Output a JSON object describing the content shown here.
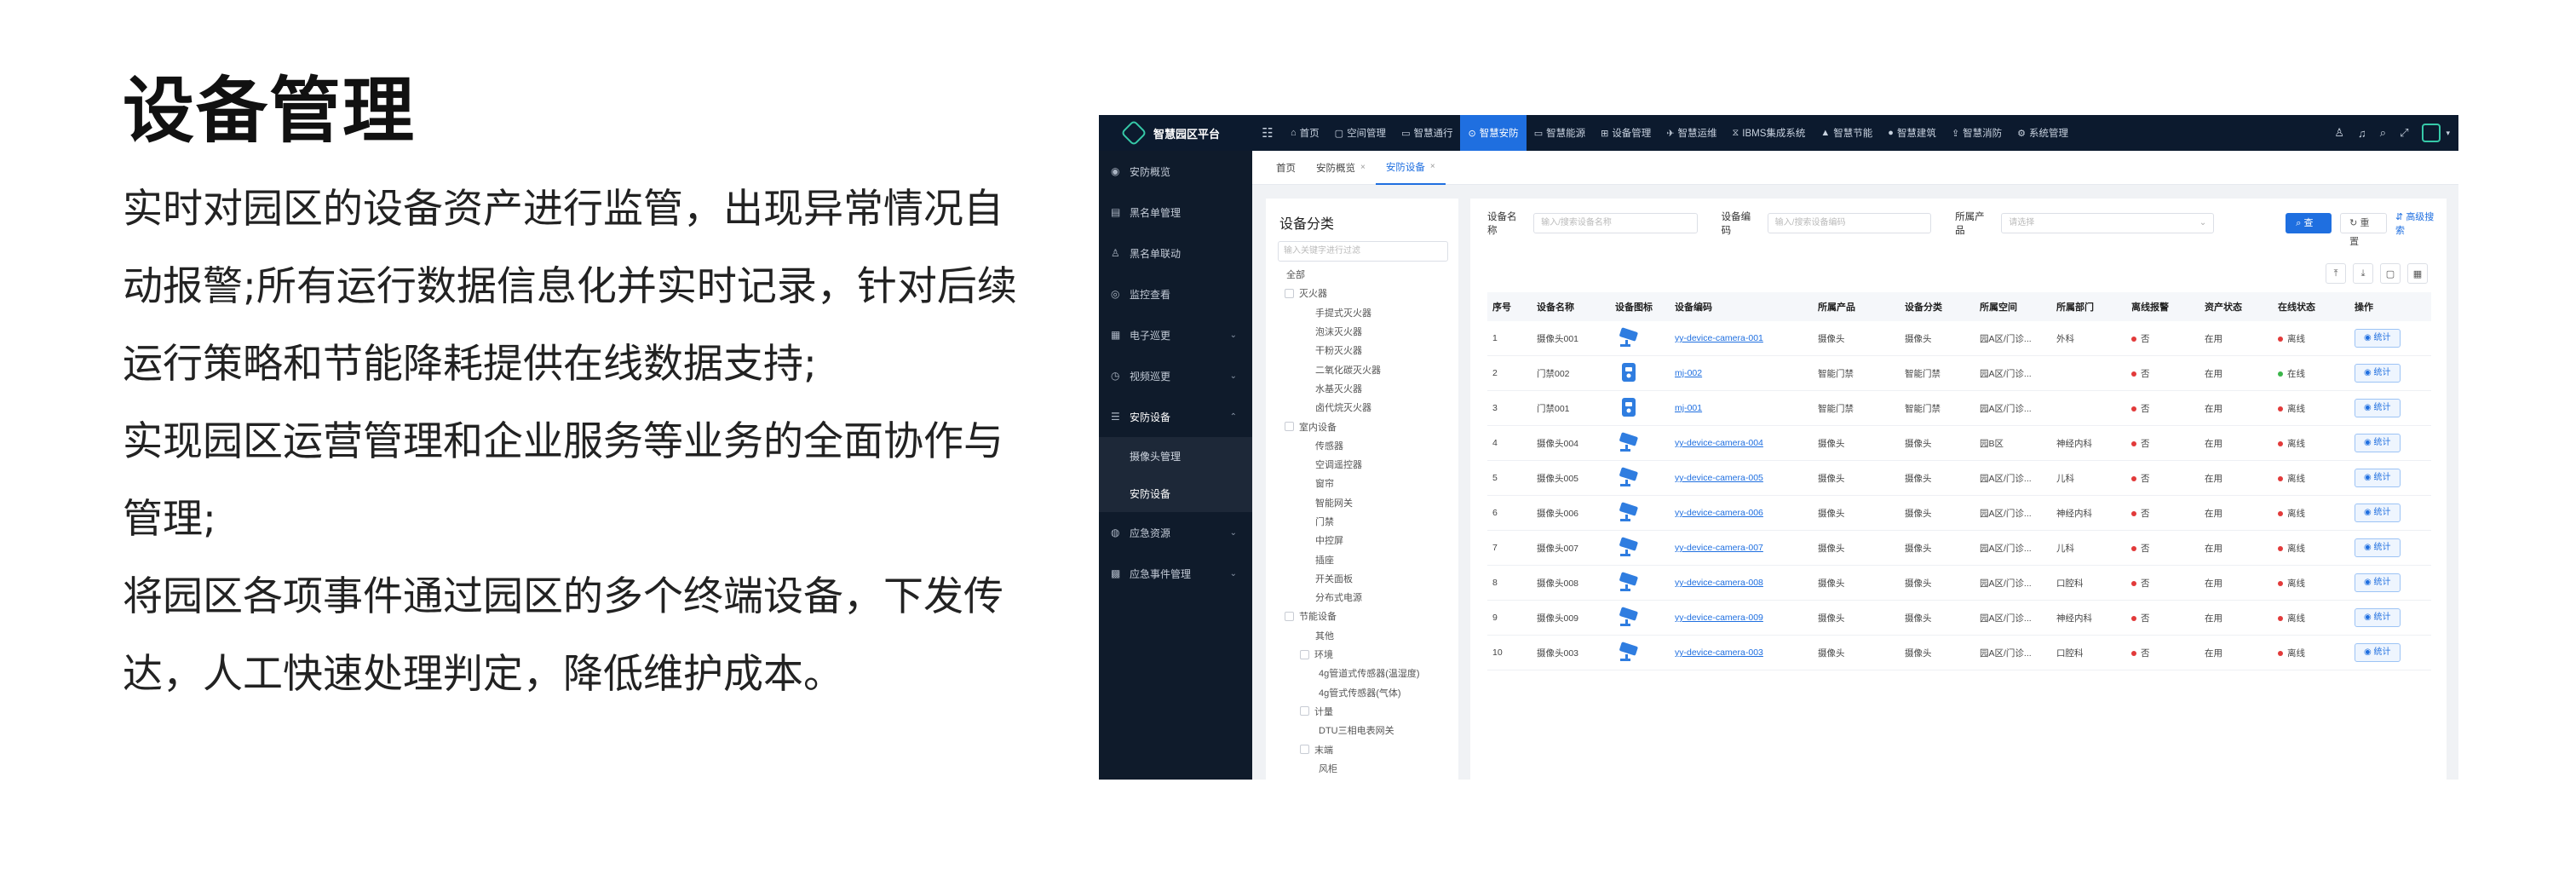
{
  "intro": {
    "title": "设备管理",
    "paragraphs": [
      "实时对园区的设备资产进行监管，出现异常情况自动报警;所有运行数据信息化并实时记录，针对后续运行策略和节能降耗提供在线数据支持;",
      "实现园区运营管理和企业服务等业务的全面协作与管理;",
      "将园区各项事件通过园区的多个终端设备，下发传达，人工快速处理判定，降低维护成本。"
    ]
  },
  "app": {
    "brand": "智慧园区平台",
    "nav": [
      {
        "label": "首页",
        "icon": "home-icon",
        "glyph": "⌂",
        "active": false
      },
      {
        "label": "空间管理",
        "icon": "space-icon",
        "glyph": "▢",
        "active": false
      },
      {
        "label": "智慧通行",
        "icon": "pass-icon",
        "glyph": "▭",
        "active": false
      },
      {
        "label": "智慧安防",
        "icon": "shield-icon",
        "glyph": "⊙",
        "active": true
      },
      {
        "label": "智慧能源",
        "icon": "energy-icon",
        "glyph": "▭",
        "active": false
      },
      {
        "label": "设备管理",
        "icon": "device-icon",
        "glyph": "⊞",
        "active": false
      },
      {
        "label": "智慧运维",
        "icon": "ops-icon",
        "glyph": "✈",
        "active": false
      },
      {
        "label": "IBMS集成系统",
        "icon": "ibms-icon",
        "glyph": "⧖",
        "active": false
      },
      {
        "label": "智慧节能",
        "icon": "saving-icon",
        "glyph": "▲",
        "active": false
      },
      {
        "label": "智慧建筑",
        "icon": "building-icon",
        "glyph": "●",
        "active": false
      },
      {
        "label": "智慧消防",
        "icon": "fire-icon",
        "glyph": "⇪",
        "active": false
      },
      {
        "label": "系统管理",
        "icon": "gear-icon",
        "glyph": "⚙",
        "active": false
      }
    ],
    "sidebar": [
      {
        "label": "安防概览",
        "icon": "overview-icon",
        "glyph": "◉",
        "arrow": false
      },
      {
        "label": "黑名单管理",
        "icon": "blacklist-icon",
        "glyph": "▤",
        "arrow": false
      },
      {
        "label": "黑名单联动",
        "icon": "link-icon",
        "glyph": "♙",
        "arrow": false
      },
      {
        "label": "监控查看",
        "icon": "eye-icon",
        "glyph": "◎",
        "arrow": false
      },
      {
        "label": "电子巡更",
        "icon": "patrol-icon",
        "glyph": "▦",
        "arrow": true
      },
      {
        "label": "视频巡更",
        "icon": "video-icon",
        "glyph": "◷",
        "arrow": true
      },
      {
        "label": "安防设备",
        "icon": "list-icon",
        "glyph": "☰",
        "arrow": true
      }
    ],
    "sidebar_sub": [
      "摄像头管理",
      "安防设备"
    ],
    "sidebar_after": [
      {
        "label": "应急资源",
        "icon": "emergency-icon",
        "glyph": "◍",
        "arrow": true
      },
      {
        "label": "应急事件管理",
        "icon": "event-icon",
        "glyph": "▩",
        "arrow": true
      }
    ],
    "tabs": [
      {
        "label": "首页",
        "closable": false
      },
      {
        "label": "安防概览",
        "closable": true
      },
      {
        "label": "安防设备",
        "closable": true
      }
    ],
    "tree": {
      "title": "设备分类",
      "search_placeholder": "输入关键字进行过滤",
      "nodes": [
        {
          "label": "全部",
          "level": "l0",
          "cb": false
        },
        {
          "label": "灭火器",
          "level": "l1",
          "cb": true
        },
        {
          "label": "手提式灭火器",
          "level": "l2",
          "cb": false
        },
        {
          "label": "泡沫灭火器",
          "level": "l2",
          "cb": false
        },
        {
          "label": "干粉灭火器",
          "level": "l2",
          "cb": false
        },
        {
          "label": "二氧化碳灭火器",
          "level": "l2",
          "cb": false
        },
        {
          "label": "水基灭火器",
          "level": "l2",
          "cb": false
        },
        {
          "label": "卤代烷灭火器",
          "level": "l2",
          "cb": false
        },
        {
          "label": "室内设备",
          "level": "l1",
          "cb": true
        },
        {
          "label": "传感器",
          "level": "l2",
          "cb": false
        },
        {
          "label": "空调遥控器",
          "level": "l2",
          "cb": false
        },
        {
          "label": "窗帘",
          "level": "l2",
          "cb": false
        },
        {
          "label": "智能网关",
          "level": "l2",
          "cb": false
        },
        {
          "label": "门禁",
          "level": "l2",
          "cb": false
        },
        {
          "label": "中控屏",
          "level": "l2",
          "cb": false
        },
        {
          "label": "插座",
          "level": "l2",
          "cb": false
        },
        {
          "label": "开关面板",
          "level": "l2",
          "cb": false
        },
        {
          "label": "分布式电源",
          "level": "l2",
          "cb": false
        },
        {
          "label": "节能设备",
          "level": "l1",
          "cb": true
        },
        {
          "label": "其他",
          "level": "l2",
          "cb": false
        },
        {
          "label": "环境",
          "level": "l2b",
          "cb": true
        },
        {
          "label": "4g管道式传感器(温湿度)",
          "level": "l3",
          "cb": false
        },
        {
          "label": "4g管式传感器(气体)",
          "level": "l3",
          "cb": false
        },
        {
          "label": "计量",
          "level": "l2b",
          "cb": true
        },
        {
          "label": "DTU三相电表网关",
          "level": "l3",
          "cb": false
        },
        {
          "label": "末端",
          "level": "l2b",
          "cb": true
        },
        {
          "label": "风柜",
          "level": "l3",
          "cb": false
        }
      ]
    },
    "filters": {
      "name_label": "设备名称",
      "name_placeholder": "输入/搜索设备名称",
      "code_label": "设备编码",
      "code_placeholder": "输入/搜索设备编码",
      "product_label": "所属产品",
      "product_placeholder": "请选择",
      "query": "查询",
      "reset": "重置",
      "advanced": "高级搜索"
    },
    "table": {
      "headers": [
        "序号",
        "设备名称",
        "设备图标",
        "设备编码",
        "所属产品",
        "设备分类",
        "所属空间",
        "所属部门",
        "离线报警",
        "资产状态",
        "在线状态",
        "操作"
      ],
      "rows": [
        {
          "no": "1",
          "name": "摄像头001",
          "icon": "camera-icon",
          "code": "yy-device-camera-001",
          "product": "摄像头",
          "category": "摄像头",
          "space": "园A区/门诊...",
          "dept": "外科",
          "alarm": "否",
          "asset": "在用",
          "online": "离线",
          "online_ok": false,
          "op": "统计"
        },
        {
          "no": "2",
          "name": "门禁002",
          "icon": "door-icon",
          "code": "mj-002",
          "product": "智能门禁",
          "category": "智能门禁",
          "space": "园A区/门诊...",
          "dept": "",
          "alarm": "否",
          "asset": "在用",
          "online": "在线",
          "online_ok": true,
          "op": "统计"
        },
        {
          "no": "3",
          "name": "门禁001",
          "icon": "door-icon",
          "code": "mj-001",
          "product": "智能门禁",
          "category": "智能门禁",
          "space": "园A区/门诊...",
          "dept": "",
          "alarm": "否",
          "asset": "在用",
          "online": "离线",
          "online_ok": false,
          "op": "统计"
        },
        {
          "no": "4",
          "name": "摄像头004",
          "icon": "camera-icon",
          "code": "yy-device-camera-004",
          "product": "摄像头",
          "category": "摄像头",
          "space": "园B区",
          "dept": "神经内科",
          "alarm": "否",
          "asset": "在用",
          "online": "离线",
          "online_ok": false,
          "op": "统计"
        },
        {
          "no": "5",
          "name": "摄像头005",
          "icon": "camera-icon",
          "code": "yy-device-camera-005",
          "product": "摄像头",
          "category": "摄像头",
          "space": "园A区/门诊...",
          "dept": "儿科",
          "alarm": "否",
          "asset": "在用",
          "online": "离线",
          "online_ok": false,
          "op": "统计"
        },
        {
          "no": "6",
          "name": "摄像头006",
          "icon": "camera-icon",
          "code": "yy-device-camera-006",
          "product": "摄像头",
          "category": "摄像头",
          "space": "园A区/门诊...",
          "dept": "神经内科",
          "alarm": "否",
          "asset": "在用",
          "online": "离线",
          "online_ok": false,
          "op": "统计"
        },
        {
          "no": "7",
          "name": "摄像头007",
          "icon": "camera-icon",
          "code": "yy-device-camera-007",
          "product": "摄像头",
          "category": "摄像头",
          "space": "园A区/门诊...",
          "dept": "儿科",
          "alarm": "否",
          "asset": "在用",
          "online": "离线",
          "online_ok": false,
          "op": "统计"
        },
        {
          "no": "8",
          "name": "摄像头008",
          "icon": "camera-icon",
          "code": "yy-device-camera-008",
          "product": "摄像头",
          "category": "摄像头",
          "space": "园A区/门诊...",
          "dept": "口腔科",
          "alarm": "否",
          "asset": "在用",
          "online": "离线",
          "online_ok": false,
          "op": "统计"
        },
        {
          "no": "9",
          "name": "摄像头009",
          "icon": "camera-icon",
          "code": "yy-device-camera-009",
          "product": "摄像头",
          "category": "摄像头",
          "space": "园A区/门诊...",
          "dept": "神经内科",
          "alarm": "否",
          "asset": "在用",
          "online": "离线",
          "online_ok": false,
          "op": "统计"
        },
        {
          "no": "10",
          "name": "摄像头003",
          "icon": "camera-icon",
          "code": "yy-device-camera-003",
          "product": "摄像头",
          "category": "摄像头",
          "space": "园A区/门诊...",
          "dept": "口腔科",
          "alarm": "否",
          "asset": "在用",
          "online": "离线",
          "online_ok": false,
          "op": "统计"
        }
      ]
    },
    "colors": {
      "accent": "#1f6fe0",
      "topbar": "#0c1a2e",
      "sidebar": "#0f1b2b",
      "logo": "#36c9a8",
      "danger": "#e23a3a",
      "success": "#3bb54a"
    }
  }
}
